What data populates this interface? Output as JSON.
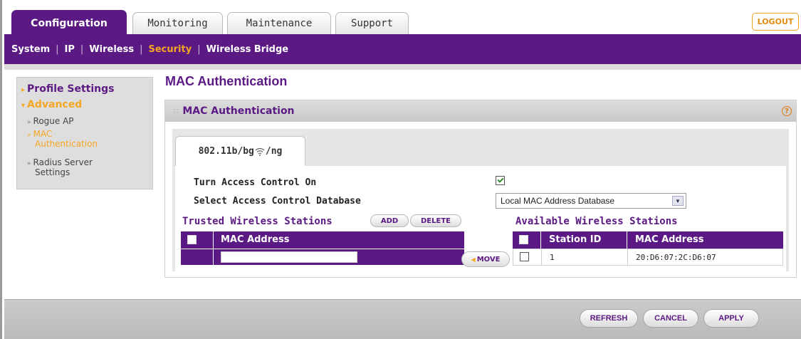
{
  "tabs": [
    {
      "label": "Configuration"
    },
    {
      "label": "Monitoring"
    },
    {
      "label": "Maintenance"
    },
    {
      "label": "Support"
    }
  ],
  "logout_label": "LOGOUT",
  "subnav": {
    "items": [
      {
        "label": "System"
      },
      {
        "label": "IP"
      },
      {
        "label": "Wireless"
      },
      {
        "label": "Security"
      },
      {
        "label": "Wireless Bridge"
      }
    ],
    "separator": "|",
    "current": "Security"
  },
  "sidebar": {
    "profile_settings": "Profile Settings",
    "advanced": "Advanced",
    "rogue_ap": "Rogue AP",
    "mac_auth_line1": "MAC",
    "mac_auth_line2": "Authentication",
    "radius_line1": "Radius Server",
    "radius_line2": "Settings"
  },
  "page_title": "MAC Authentication",
  "panel": {
    "title": "MAC Authentication",
    "help": "?",
    "band_tab_prefix": "802.11b/bg",
    "band_tab_suffix": "/ng"
  },
  "form": {
    "access_control_label": "Turn Access Control On",
    "access_control_checked": true,
    "database_label": "Select Access Control Database",
    "database_value": "Local MAC Address Database"
  },
  "trusted": {
    "title": "Trusted Wireless Stations",
    "add_label": "ADD",
    "delete_label": "DELETE",
    "col_mac": "MAC Address",
    "input_value": ""
  },
  "move_label": "MOVE",
  "available": {
    "title": "Available Wireless Stations",
    "col_station": "Station ID",
    "col_mac": "MAC Address",
    "rows": [
      {
        "station_id": "1",
        "mac": "20:D6:07:2C:D6:07"
      }
    ]
  },
  "footer": {
    "refresh": "REFRESH",
    "cancel": "CANCEL",
    "apply": "APPLY"
  },
  "colors": {
    "brand_purple": "#5b1a83",
    "accent_orange": "#f5a623"
  }
}
